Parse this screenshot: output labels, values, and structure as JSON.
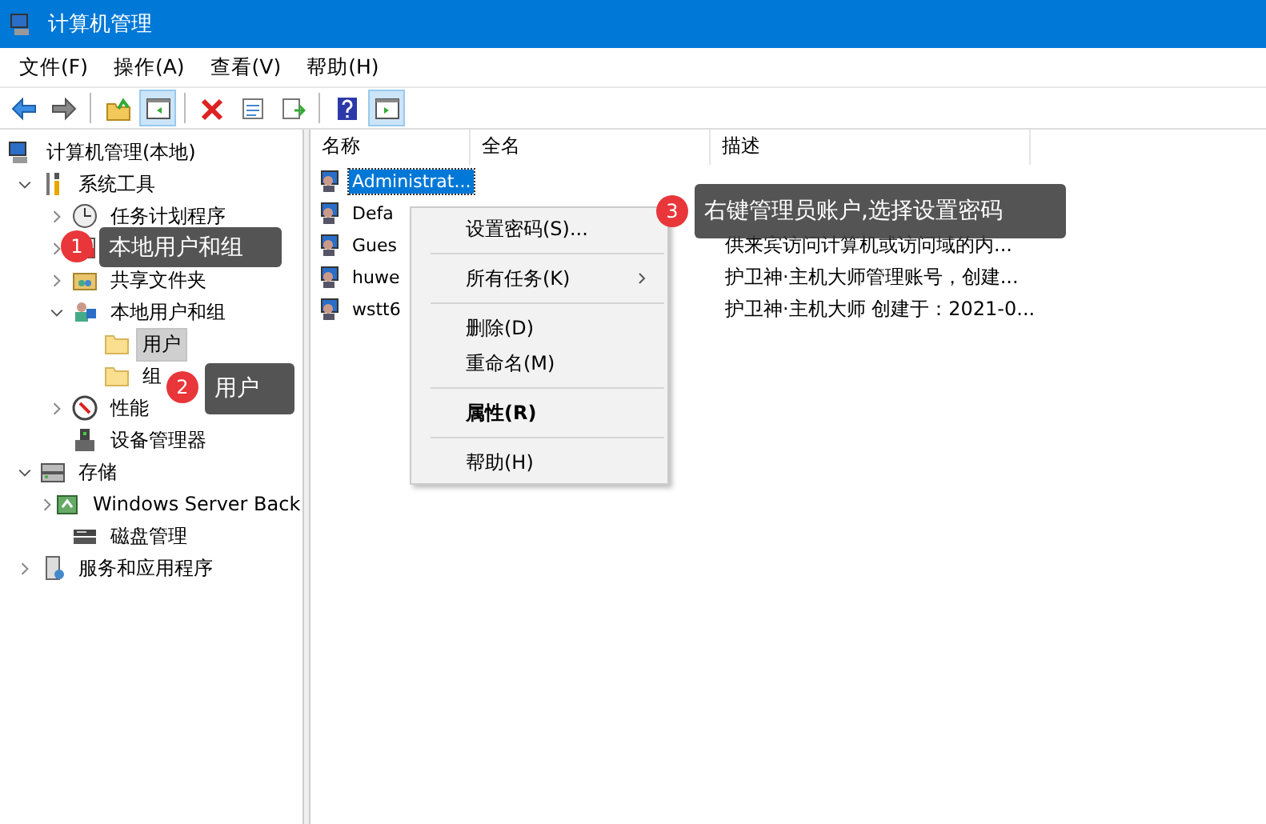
{
  "window": {
    "title": "计算机管理"
  },
  "menu_bar": [
    "文件(F)",
    "操作(A)",
    "查看(V)",
    "帮助(H)"
  ],
  "toolbar": [
    {
      "kind": "back",
      "pressed": false
    },
    {
      "kind": "forward",
      "pressed": false
    },
    {
      "kind": "sep"
    },
    {
      "kind": "up",
      "pressed": false
    },
    {
      "kind": "pane",
      "pressed": true
    },
    {
      "kind": "sep"
    },
    {
      "kind": "delete",
      "pressed": false
    },
    {
      "kind": "properties",
      "pressed": false
    },
    {
      "kind": "export",
      "pressed": false
    },
    {
      "kind": "sep"
    },
    {
      "kind": "help",
      "pressed": false
    },
    {
      "kind": "action-pane",
      "pressed": true
    }
  ],
  "tree": [
    {
      "label": "计算机管理(本地)",
      "kind": "computer",
      "selected": false,
      "children": [
        {
          "label": "系统工具",
          "kind": "tools",
          "expanded": true,
          "selected": false,
          "children": [
            {
              "label": "任务计划程序",
              "kind": "clock",
              "expanded": false,
              "selected": false
            },
            {
              "kind": "event",
              "expanded": false
            },
            {
              "label": "共享文件夹",
              "kind": "share",
              "expanded": false,
              "selected": false
            },
            {
              "label": "本地用户和组",
              "kind": "users",
              "expanded": true,
              "selected": false,
              "children": [
                {
                  "label": "用户",
                  "kind": "folder",
                  "selected": true
                },
                {
                  "label": "组",
                  "kind": "folder",
                  "selected": false
                }
              ]
            },
            {
              "label": "性能",
              "kind": "gauge",
              "expanded": false,
              "selected": false
            },
            {
              "label": "设备管理器",
              "kind": "device",
              "selected": false
            }
          ]
        },
        {
          "label": "存储",
          "kind": "storage",
          "expanded": true,
          "selected": false,
          "children": [
            {
              "label": "Windows Server Back",
              "kind": "backup",
              "expanded": false,
              "selected": false
            },
            {
              "label": "磁盘管理",
              "kind": "disk",
              "selected": false
            }
          ]
        },
        {
          "label": "服务和应用程序",
          "kind": "services",
          "expanded": false,
          "selected": false
        }
      ]
    }
  ],
  "table": {
    "columns": [
      "名称",
      "全名",
      "描述"
    ],
    "rows": [
      {
        "name": "Administrat...",
        "selected": true
      },
      {
        "name": "Defa",
        "selected": false
      },
      {
        "name": "Gues",
        "description": "供来宾访问计算机或访问域的内...",
        "selected": false
      },
      {
        "name": "huwe",
        "description": "护卫神·主机大师管理账号，创建...",
        "selected": false
      },
      {
        "name": "wstt6",
        "description": "护卫神·主机大师 创建于：2021-0...",
        "selected": false
      }
    ]
  },
  "context_menu": [
    {
      "kind": "item",
      "label": "设置密码(S)..."
    },
    {
      "kind": "separator"
    },
    {
      "kind": "item",
      "label": "所有任务(K)",
      "submenu": true
    },
    {
      "kind": "separator"
    },
    {
      "kind": "item",
      "label": "删除(D)"
    },
    {
      "kind": "item",
      "label": "重命名(M)"
    },
    {
      "kind": "separator"
    },
    {
      "kind": "item",
      "label": "属性(R)",
      "bold": true
    },
    {
      "kind": "separator"
    },
    {
      "kind": "item",
      "label": "帮助(H)"
    }
  ],
  "callouts": [
    {
      "number": "1",
      "text": "本地用户和组"
    },
    {
      "number": "2",
      "text": "用户"
    },
    {
      "number": "3",
      "text": "右键管理员账户,选择设置密码"
    }
  ]
}
